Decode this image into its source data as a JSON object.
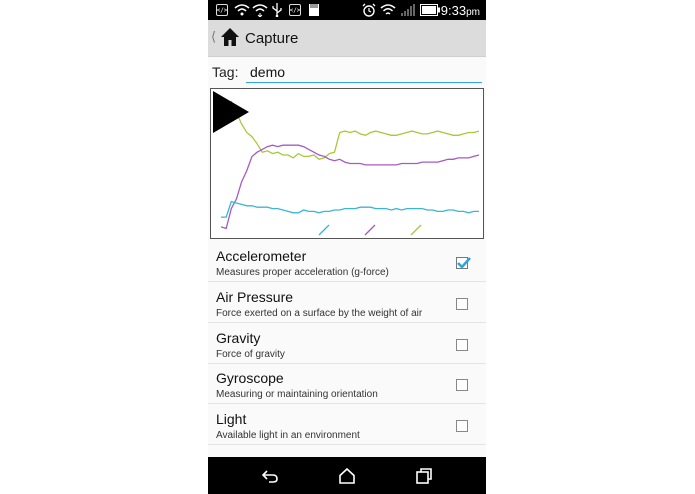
{
  "status_bar": {
    "time": "9:33",
    "pm": "pm",
    "left_icons": [
      "code-icon",
      "wifi-question-icon",
      "wifi-arrows-icon",
      "usb-icon",
      "code-icon",
      "sd-card-icon"
    ],
    "right_icons": [
      "alarm-icon",
      "wifi-icon",
      "signal-icon",
      "battery-icon"
    ]
  },
  "action_bar": {
    "title": "Capture"
  },
  "tag": {
    "label": "Tag:",
    "value": "demo"
  },
  "chart_data": {
    "type": "line",
    "x": [
      0,
      1,
      2,
      3,
      4,
      5,
      6,
      7,
      8,
      9,
      10,
      11,
      12,
      13,
      14,
      15,
      16,
      17,
      18,
      19,
      20,
      21,
      22,
      23,
      24,
      25,
      26,
      27,
      28,
      29,
      30,
      31,
      32,
      33,
      34,
      35,
      36,
      37,
      38,
      39,
      40,
      41,
      42,
      43,
      44,
      45,
      46,
      47,
      48,
      49,
      50
    ],
    "series": [
      {
        "color": "#a8c83a",
        "values": [
          88,
          91,
          94,
          86,
          78,
          72,
          69,
          64,
          58,
          59,
          57,
          58,
          56,
          56,
          54,
          57,
          55,
          55,
          56,
          53,
          54,
          57,
          58,
          72,
          73,
          72,
          73,
          71,
          70,
          72,
          73,
          72,
          71,
          70,
          70,
          71,
          72,
          73,
          72,
          71,
          71,
          72,
          73,
          72,
          71,
          70,
          70,
          71,
          72,
          72,
          73
        ]
      },
      {
        "color": "#a55bc3",
        "values": [
          5,
          4,
          18,
          25,
          37,
          45,
          55,
          58,
          60,
          62,
          63,
          62,
          63,
          63,
          63,
          63,
          62,
          60,
          58,
          56,
          55,
          53,
          52,
          53,
          51,
          50,
          50,
          50,
          49,
          49,
          49,
          49,
          49,
          49,
          49,
          50,
          50,
          50,
          50,
          51,
          51,
          51,
          51,
          52,
          53,
          53,
          54,
          54,
          54,
          55,
          56
        ]
      },
      {
        "color": "#3cb6d6",
        "values": [
          12,
          12,
          23,
          22,
          21,
          20,
          20,
          19,
          19,
          19,
          18,
          18,
          17,
          16,
          15,
          15,
          17,
          16,
          16,
          15,
          16,
          16,
          17,
          17,
          18,
          18,
          18,
          19,
          19,
          19,
          18,
          18,
          18,
          17,
          18,
          17,
          18,
          18,
          18,
          18,
          17,
          17,
          16,
          16,
          17,
          17,
          16,
          16,
          15,
          16,
          16
        ]
      }
    ],
    "marks": [
      {
        "color": "#3cb6d6",
        "label": "/"
      },
      {
        "color": "#a55bc3",
        "label": "/"
      },
      {
        "color": "#a8c83a",
        "label": "/"
      }
    ],
    "ylim": [
      0,
      100
    ]
  },
  "sensors": [
    {
      "name": "Accelerometer",
      "description": "Measures proper acceleration (g-force)",
      "checked": true
    },
    {
      "name": "Air Pressure",
      "description": "Force exerted on a surface by the weight of air",
      "checked": false
    },
    {
      "name": "Gravity",
      "description": "Force of gravity",
      "checked": false
    },
    {
      "name": "Gyroscope",
      "description": "Measuring or maintaining orientation",
      "checked": false
    },
    {
      "name": "Light",
      "description": "Available light in an environment",
      "checked": false
    }
  ],
  "nav_bar": {
    "buttons": [
      "back-icon",
      "home-icon",
      "recent-apps-icon"
    ]
  },
  "colors": {
    "accent": "#33a4d8",
    "status_bar": "#000000",
    "action_bar": "#dcdcdc"
  }
}
